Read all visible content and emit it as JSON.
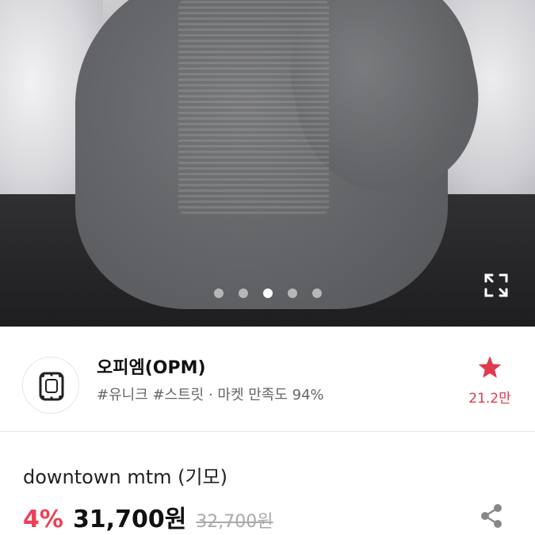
{
  "gallery": {
    "dot_count": 5,
    "active_index": 2
  },
  "store": {
    "name": "오피엠(OPM)",
    "tags": "#유니크 #스트릿 · 마켓 만족도 94%",
    "favorite_count": "21.2만"
  },
  "product": {
    "name": "downtown mtm (기모)",
    "discount": "4%",
    "price": "31,700원",
    "original_price": "32,700원"
  },
  "icons": {
    "expand": "expand-icon",
    "favorite": "star-icon",
    "share": "share-icon",
    "store_logo": "store-logo"
  },
  "colors": {
    "accent": "#ef3f55",
    "favorite": "#e03a4e"
  }
}
